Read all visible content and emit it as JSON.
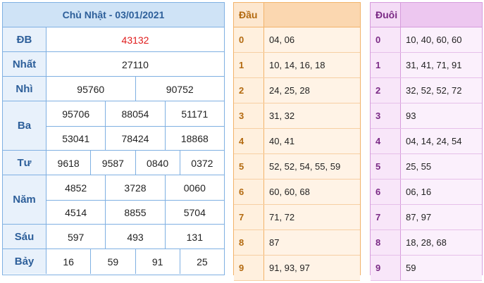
{
  "results": {
    "title": "Chủ Nhật - 03/01/2021",
    "prizes": [
      {
        "name": "ĐB",
        "lines": [
          [
            "43132"
          ]
        ],
        "special": true
      },
      {
        "name": "Nhất",
        "lines": [
          [
            "27110"
          ]
        ]
      },
      {
        "name": "Nhì",
        "lines": [
          [
            "95760",
            "90752"
          ]
        ]
      },
      {
        "name": "Ba",
        "lines": [
          [
            "95706",
            "88054",
            "51171"
          ],
          [
            "53041",
            "78424",
            "18868"
          ]
        ]
      },
      {
        "name": "Tư",
        "lines": [
          [
            "9618",
            "9587",
            "0840",
            "0372"
          ]
        ]
      },
      {
        "name": "Năm",
        "lines": [
          [
            "4852",
            "3728",
            "0060"
          ],
          [
            "4514",
            "8855",
            "5704"
          ]
        ]
      },
      {
        "name": "Sáu",
        "lines": [
          [
            "597",
            "493",
            "131"
          ]
        ]
      },
      {
        "name": "Bảy",
        "lines": [
          [
            "16",
            "59",
            "91",
            "25"
          ]
        ]
      }
    ]
  },
  "dau": {
    "header": "Đầu",
    "rows": [
      {
        "k": "0",
        "v": "04, 06"
      },
      {
        "k": "1",
        "v": "10, 14, 16, 18"
      },
      {
        "k": "2",
        "v": "24, 25, 28"
      },
      {
        "k": "3",
        "v": "31, 32"
      },
      {
        "k": "4",
        "v": "40, 41"
      },
      {
        "k": "5",
        "v": "52, 52, 54, 55, 59"
      },
      {
        "k": "6",
        "v": "60, 60, 68"
      },
      {
        "k": "7",
        "v": "71, 72"
      },
      {
        "k": "8",
        "v": "87"
      },
      {
        "k": "9",
        "v": "91, 93, 97"
      }
    ]
  },
  "duoi": {
    "header": "Đuôi",
    "rows": [
      {
        "k": "0",
        "v": "10, 40, 60, 60"
      },
      {
        "k": "1",
        "v": "31, 41, 71, 91"
      },
      {
        "k": "2",
        "v": "32, 52, 52, 72"
      },
      {
        "k": "3",
        "v": "93"
      },
      {
        "k": "4",
        "v": "04, 14, 24, 54"
      },
      {
        "k": "5",
        "v": "25, 55"
      },
      {
        "k": "6",
        "v": "06, 16"
      },
      {
        "k": "7",
        "v": "87, 97"
      },
      {
        "k": "8",
        "v": "18, 28, 68"
      },
      {
        "k": "9",
        "v": "59"
      }
    ]
  }
}
